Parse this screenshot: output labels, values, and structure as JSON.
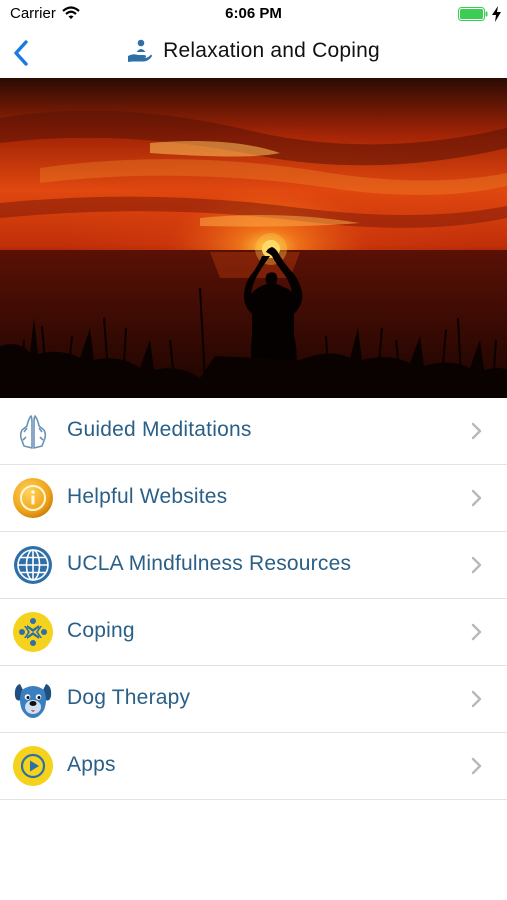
{
  "status": {
    "carrier": "Carrier",
    "time": "6:06 PM"
  },
  "nav": {
    "title": "Relaxation and Coping"
  },
  "icons": {
    "back": "chevron-left-icon",
    "title": "hand-holding-person-icon",
    "row_chevron": "chevron-right-icon"
  },
  "colors": {
    "accent_blue": "#1a7ae0",
    "label_blue": "#2a5f87",
    "icon_yellow": "#f5d21c",
    "icon_blue": "#2f6fa8",
    "battery_green": "#3ccd55"
  },
  "menu": {
    "items": [
      {
        "label": "Guided Meditations",
        "icon": "praying-hands-icon"
      },
      {
        "label": "Helpful Websites",
        "icon": "info-icon"
      },
      {
        "label": "UCLA Mindfulness Resources",
        "icon": "globe-icon"
      },
      {
        "label": "Coping",
        "icon": "people-circle-icon"
      },
      {
        "label": "Dog Therapy",
        "icon": "dog-icon"
      },
      {
        "label": "Apps",
        "icon": "play-icon"
      }
    ]
  }
}
